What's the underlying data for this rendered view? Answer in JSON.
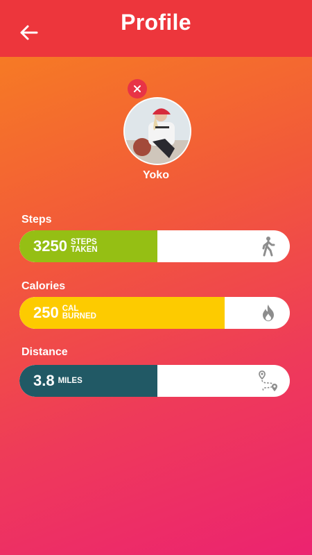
{
  "header": {
    "title": "Profile",
    "back_icon": "arrow-left-icon"
  },
  "profile": {
    "name": "Yoko",
    "remove_icon": "close-icon"
  },
  "stats": [
    {
      "label": "Steps",
      "value": "3250",
      "unit_line1": "STEPS",
      "unit_line2": "TAKEN",
      "icon": "walking-icon",
      "color": "#95bf14",
      "progress": 0.51
    },
    {
      "label": "Calories",
      "value": "250",
      "unit_line1": "CAL",
      "unit_line2": "BURNED",
      "icon": "flame-icon",
      "color": "#fdcb00",
      "progress": 0.76
    },
    {
      "label": "Distance",
      "value": "3.8",
      "unit_line1": "MILES",
      "unit_line2": "",
      "icon": "route-icon",
      "color": "#215965",
      "progress": 0.51
    }
  ]
}
